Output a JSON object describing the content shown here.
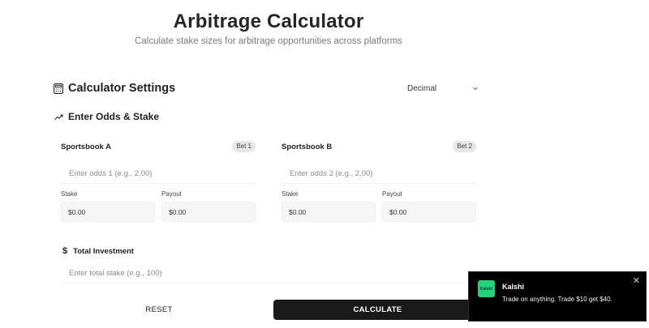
{
  "header": {
    "title": "Arbitrage Calculator",
    "subtitle": "Calculate stake sizes for arbitrage opportunities across platforms"
  },
  "settings": {
    "title": "Calculator Settings",
    "icon": "calculator-icon",
    "odds_format": "Decimal"
  },
  "odds_section": {
    "title": "Enter Odds & Stake",
    "icon": "trending-up-icon"
  },
  "bets": [
    {
      "name": "Sportsbook A",
      "badge": "Bet 1",
      "odds_placeholder": "Enter odds 1 (e.g., 2.00)",
      "stake_label": "Stake",
      "stake_value": "$0.00",
      "payout_label": "Payout",
      "payout_value": "$0.00"
    },
    {
      "name": "Sportsbook B",
      "badge": "Bet 2",
      "odds_placeholder": "Enter odds 2 (e.g., 2.00)",
      "stake_label": "Stake",
      "stake_value": "$0.00",
      "payout_label": "Payout",
      "payout_value": "$0.00"
    }
  ],
  "total": {
    "icon_glyph": "$",
    "title": "Total Investment",
    "placeholder": "Enter total stake (e.g., 100)"
  },
  "actions": {
    "reset_label": "RESET",
    "calculate_label": "CALCULATE"
  },
  "ad": {
    "logo_text": "Kalshi",
    "brand": "Kalshi",
    "text": "Trade on anything. Trade $10 get $40.",
    "close_glyph": "✕",
    "accent": "#1ed37a"
  }
}
